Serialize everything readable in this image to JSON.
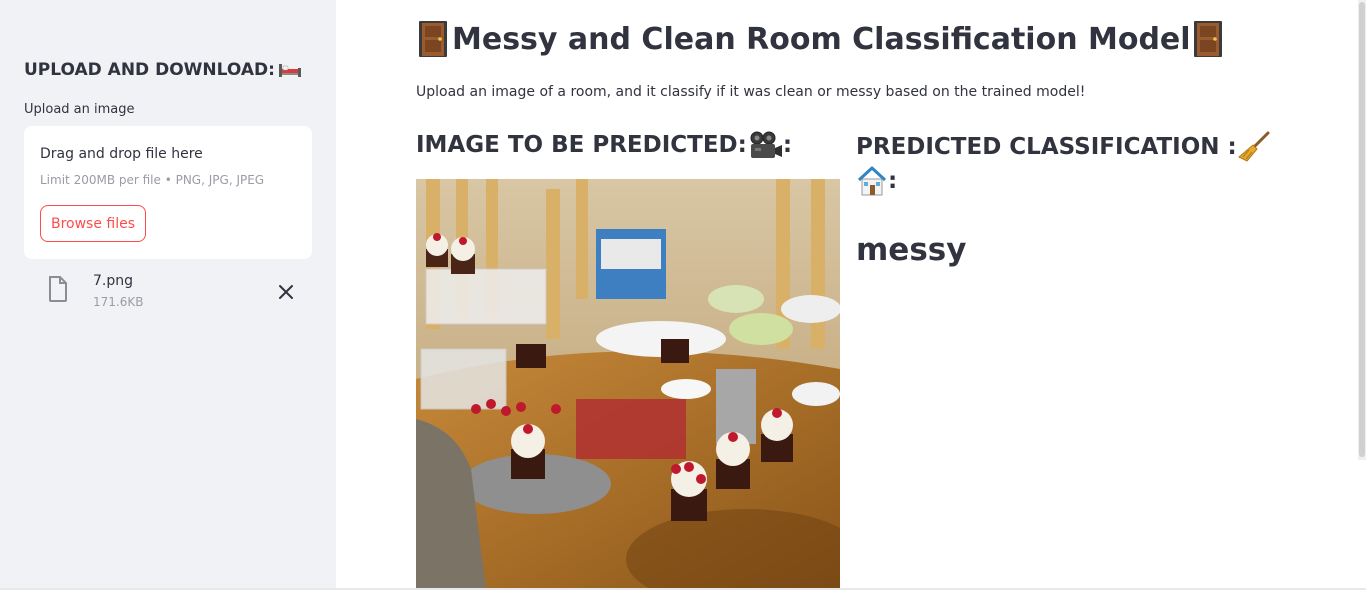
{
  "sidebar": {
    "header": "UPLOAD AND DOWNLOAD:",
    "header_icon": "bed-icon",
    "upload_label": "Upload an image",
    "dropzone": {
      "title": "Drag and drop file here",
      "limit": "Limit 200MB per file • PNG, JPG, JPEG",
      "browse_label": "Browse files"
    },
    "file": {
      "name": "7.png",
      "size": "171.6KB",
      "icon": "file-icon"
    }
  },
  "main": {
    "title": "Messy and Clean Room Classification Model",
    "title_icon": "door-icon",
    "subtitle": "Upload an image of a room, and it classify if it was clean or messy based on the trained model!",
    "col1_header": "IMAGE TO BE PREDICTED:",
    "col1_suffix": ":",
    "col1_icon": "camera-icon",
    "col2_header": "PREDICTED CLASSIFICATION :",
    "col2_suffix": ":",
    "col2_icons": [
      "broom-icon",
      "house-icon"
    ],
    "prediction": "messy"
  },
  "colors": {
    "accent": "#ff4b4b",
    "sidebar_bg": "#f0f2f6",
    "text": "#31333f",
    "muted": "#9a9ca5"
  }
}
